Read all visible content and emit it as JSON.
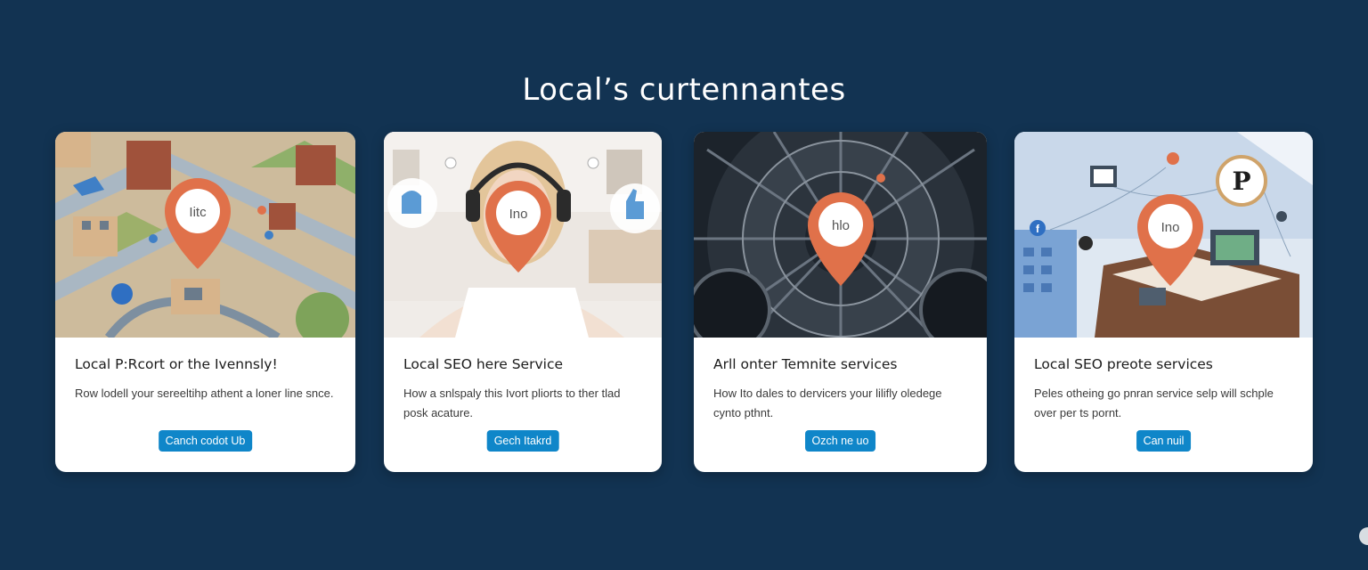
{
  "page": {
    "title": "Local’s curtennantes"
  },
  "cards": [
    {
      "pin_label": "Iitc",
      "title": "Local P:Rcort or the Ivennsly!",
      "description": "Row lodell your sereeltihp athent a loner line snce.",
      "button_label": "Canch codot Ub"
    },
    {
      "pin_label": "Ino",
      "title": "Local SEO here Service",
      "description": "How a snlspaly this Ivort pliorts to ther tlad posk acature.",
      "button_label": "Gech Itakrd"
    },
    {
      "pin_label": "hlo",
      "title": "Arll onter Temnite services",
      "description": "How Ito dales to dervicers your lilifly oledege cynto pthnt.",
      "button_label": "Ozch ne uo"
    },
    {
      "pin_label": "Ino",
      "title": "Local SEO preote services",
      "description": "Peles otheing go pnran service selp will schple over per ts pornt.",
      "button_label": "Can nuil"
    }
  ],
  "colors": {
    "background": "#123352",
    "pin": "#e0714a",
    "button": "#0f86c9"
  },
  "icons": [
    "location-pin-icon",
    "thumbs-up-icon",
    "facebook-icon",
    "pinterest-icon"
  ]
}
